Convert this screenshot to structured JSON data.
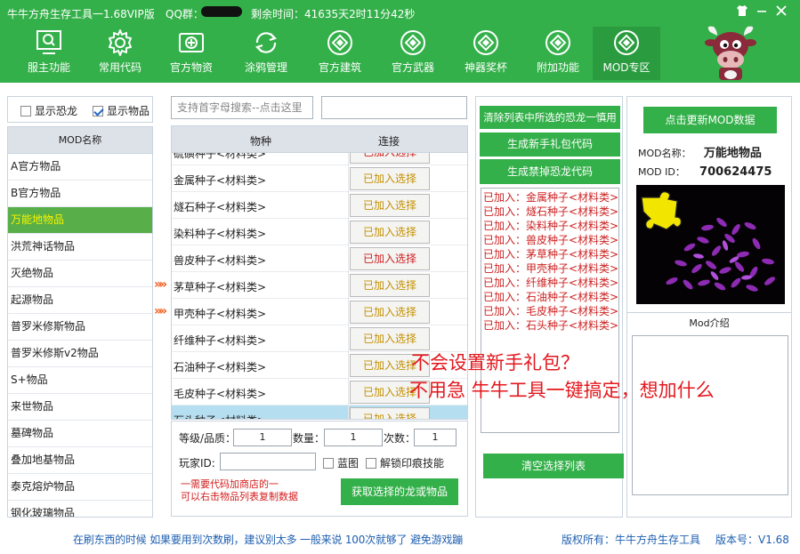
{
  "titlebar": {
    "title": "牛牛方舟生存工具一1.68VIP版",
    "qq_label": "QQ群：",
    "remaining": "剩余时间：41635天2时11分42秒"
  },
  "nav": [
    {
      "label": "服主功能",
      "icon": "screen-search-icon"
    },
    {
      "label": "常用代码",
      "icon": "gear-icon"
    },
    {
      "label": "官方物资",
      "icon": "plus-box-icon"
    },
    {
      "label": "涂鸦管理",
      "icon": "refresh-icon"
    },
    {
      "label": "官方建筑",
      "icon": "coin-icon"
    },
    {
      "label": "官方武器",
      "icon": "coin-icon"
    },
    {
      "label": "神器奖杯",
      "icon": "coin-icon"
    },
    {
      "label": "附加功能",
      "icon": "coin-icon"
    },
    {
      "label": "MOD专区",
      "icon": "coin-icon"
    }
  ],
  "filters": {
    "show_dino": "显示恐龙",
    "show_item": "显示物品"
  },
  "modlist": {
    "header": "MOD名称",
    "items": [
      "A官方物品",
      "B官方物品",
      "万能地物品",
      "洪荒神话物品",
      "灭绝物品",
      "起源物品",
      "普罗米修斯物品",
      "普罗米修斯v2物品",
      "S+物品",
      "来世物品",
      "墓碑物品",
      "叠加地基物品",
      "泰克熔炉物品",
      "钢化玻璃物品"
    ]
  },
  "search": {
    "placeholder": "支持首字母搜索--点击这里"
  },
  "items_table": {
    "col_item": "物种",
    "col_link": "连接",
    "rows": [
      {
        "name": "硫磺种子<材料类>",
        "btn": "已加入选择"
      },
      {
        "name": "金属种子<材料类>",
        "btn": "已加入选择"
      },
      {
        "name": "燧石种子<材料类>",
        "btn": "已加入选择"
      },
      {
        "name": "染料种子<材料类>",
        "btn": "已加入选择"
      },
      {
        "name": "兽皮种子<材料类>",
        "btn": "已加入选择"
      },
      {
        "name": "茅草种子<材料类>",
        "btn": "已加入选择"
      },
      {
        "name": "甲壳种子<材料类>",
        "btn": "已加入选择"
      },
      {
        "name": "纤维种子<材料类>",
        "btn": "已加入选择"
      },
      {
        "name": "石油种子<材料类>",
        "btn": "已加入选择"
      },
      {
        "name": "毛皮种子<材料类>",
        "btn": "已加入选择"
      },
      {
        "name": "石头种子<材料类>",
        "btn": "已加入选择"
      }
    ]
  },
  "form": {
    "level_label": "等级/品质：",
    "level_value": "1",
    "qty_label": "数量：",
    "qty_value": "1",
    "times_label": "次数：",
    "times_value": "1",
    "player_label": "玩家ID:",
    "blueprint_label": "蓝图",
    "unlock_label": "解锁印痕技能",
    "note_line1": "一需要代码加商店的一",
    "note_line2": "可以右击物品列表复制数据",
    "get_button": "获取选择的龙或物品"
  },
  "mid": {
    "clear_selected": "清除列表中所选的恐龙一慎用",
    "gen_gift": "生成新手礼包代码",
    "gen_ban": "生成禁掉恐龙代码",
    "added": [
      "已加入：金属种子<材料类>",
      "已加入：燧石种子<材料类>",
      "已加入：染料种子<材料类>",
      "已加入：兽皮种子<材料类>",
      "已加入：茅草种子<材料类>",
      "已加入：甲壳种子<材料类>",
      "已加入：纤维种子<材料类>",
      "已加入：石油种子<材料类>",
      "已加入：毛皮种子<材料类>",
      "已加入：石头种子<材料类>"
    ],
    "clear_list": "清空选择列表"
  },
  "right": {
    "update_button": "点击更新MOD数据",
    "name_label": "MOD名称：",
    "name_value": "万能地物品",
    "id_label": "MOD  ID：",
    "id_value": "700624475",
    "intro_label": "Mod介绍"
  },
  "overlay": {
    "line1": "不会设置新手礼包？",
    "line2": "不用急 牛牛工具一键搞定，想加什么"
  },
  "footer": {
    "tip": "在刷东西的时候 如果要用到次数刷，建议别太多  一般来说 100次就够了 避免游戏蹦",
    "copyright": "版权所有：牛牛方舟生存工具",
    "version": "版本号：V1.68"
  },
  "colors": {
    "accent": "#34b04a",
    "selected_text": "#f8f300",
    "warning": "#e3171d"
  }
}
